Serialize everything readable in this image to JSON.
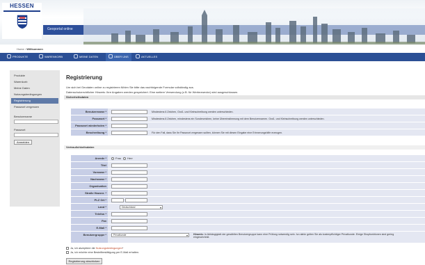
{
  "header": {
    "logo_text": "HESSEN",
    "tagline": "Geoportal online"
  },
  "breadcrumb": {
    "home": "Home",
    "separator": "›",
    "current": "Willkommen"
  },
  "nav": {
    "items": [
      {
        "label": "PRODUKTE"
      },
      {
        "label": "WARENKORB"
      },
      {
        "label": "MEINE DATEN"
      },
      {
        "label": "ÜBER UNS"
      },
      {
        "label": "AKTUELLES"
      }
    ],
    "active_index": 3
  },
  "sidebar": {
    "items": [
      {
        "label": "Produkte"
      },
      {
        "label": "Warenkorb"
      },
      {
        "label": "Meine Daten"
      },
      {
        "label": "Nutzungsbedingungen"
      },
      {
        "label": "Registrierung"
      },
      {
        "label": "Passwort vergessen"
      }
    ],
    "active_index": 4,
    "login": {
      "username_label": "Benutzername",
      "password_label": "Passwort",
      "button_label": "Anmelden"
    }
  },
  "main": {
    "title": "Registrierung",
    "intro_1": "Um sich bei Geodaten online zu registrieren fühlen Sie bitte das nachfolgende Formular vollständig aus.",
    "intro_2": "Datenschutzrechtlicher Hinweis: Ihre Angaben werden gespeichert. Eine weitere Verwendung (z.B. für Werbezwecke) wird ausgeschlossen.",
    "security_section": "Sicherheitsdaten",
    "security_fields": [
      {
        "label": "Benutzername *",
        "hint": "Mindestens 6 Zeichen, Groß- und Kleinschreibung werden unterschieden."
      },
      {
        "label": "Passwort *",
        "hint": "Mindestens 8 Zeichen, mindestens ein Sonderzeichen, keine Übereinstimmung mit dem Benutzernamen. Groß- und Kleinschreibung werden unterschieden."
      },
      {
        "label": "Passwort wiederholen *",
        "hint": ""
      },
      {
        "label": "Beschreibung *",
        "hint": "Für den Fall, dass Sie Ihr Passwort vergessen sollten, können Sie mit diesen Eingabe eine Erinnerungshilfe erzeugen."
      }
    ],
    "personal_section": "Vertraulichkeitsdaten",
    "salutation": {
      "label": "Anrede *",
      "option_1": "Frau",
      "option_2": "Herr"
    },
    "personal_fields": [
      {
        "label": "Titel"
      },
      {
        "label": "Vorname *"
      },
      {
        "label": "Nachname *"
      },
      {
        "label": "Organisation"
      },
      {
        "label": "Straße Hausnr. *"
      },
      {
        "label": "PLZ Ort *"
      },
      {
        "label": "Land *"
      },
      {
        "label": "Telefon *"
      },
      {
        "label": "Fax"
      },
      {
        "label": "E-Mail *"
      },
      {
        "label": "Benutzergruppe *"
      }
    ],
    "country_value": "Deutschland",
    "group_value": "Privatkunde",
    "group_hint_label": "Hinweis:",
    "group_hint_1": "In Abhängigkeit der gewählten Benutzergruppe kann eine Prüfung notwendig sein. Ivo dahin gelten Sie als kostenpflichtiger Privatkunde. Einige Shopfunktionen sind gering",
    "group_hint_2": "eingeschränkt.",
    "agree_prefix": "Ja, ich akzeptiere die",
    "agree_link": "Nutzungsbedingungen",
    "agree_suffix": "*",
    "confirm_label": "Ja, ich möchte eine Bestellbestätigung per E-Mail erhalten.",
    "submit_label": "Registrierung abschicken"
  }
}
